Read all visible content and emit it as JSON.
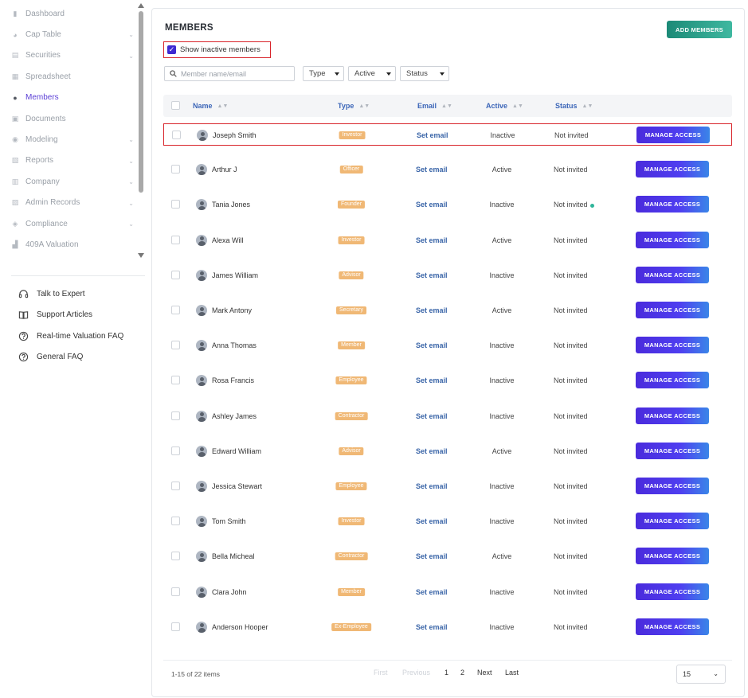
{
  "sidebar": {
    "nav": [
      {
        "label": "Dashboard",
        "icon": "dashboard-icon",
        "has_chevron": false
      },
      {
        "label": "Cap Table",
        "icon": "pie-chart-icon",
        "has_chevron": true
      },
      {
        "label": "Securities",
        "icon": "clipboard-icon",
        "has_chevron": true
      },
      {
        "label": "Spreadsheet",
        "icon": "spreadsheet-icon",
        "has_chevron": false
      },
      {
        "label": "Members",
        "icon": "user-icon",
        "has_chevron": false,
        "active": true
      },
      {
        "label": "Documents",
        "icon": "documents-icon",
        "has_chevron": false
      },
      {
        "label": "Modeling",
        "icon": "lightbulb-icon",
        "has_chevron": true
      },
      {
        "label": "Reports",
        "icon": "reports-icon",
        "has_chevron": true
      },
      {
        "label": "Company",
        "icon": "company-icon",
        "has_chevron": true
      },
      {
        "label": "Admin Records",
        "icon": "admin-records-icon",
        "has_chevron": true
      },
      {
        "label": "Compliance",
        "icon": "shield-icon",
        "has_chevron": true
      },
      {
        "label": "409A Valuation",
        "icon": "valuation-icon",
        "has_chevron": false
      }
    ],
    "help": [
      {
        "label": "Talk to Expert",
        "icon": "headset-icon"
      },
      {
        "label": "Support Articles",
        "icon": "book-icon"
      },
      {
        "label": "Real-time Valuation FAQ",
        "icon": "question-circle-icon"
      },
      {
        "label": "General FAQ",
        "icon": "question-circle-icon"
      }
    ]
  },
  "main": {
    "title": "MEMBERS",
    "add_button": "ADD MEMBERS",
    "show_inactive_label": "Show inactive members",
    "show_inactive_checked": true,
    "search_placeholder": "Member name/email",
    "filters": [
      "Type",
      "Active",
      "Status"
    ],
    "columns": [
      "Name",
      "Type",
      "Email",
      "Active",
      "Status"
    ],
    "rows": [
      {
        "name": "Joseph Smith",
        "type": "Investor",
        "email": "Set email",
        "active": "Inactive",
        "status": "Not invited",
        "status_dot": false,
        "action": "MANAGE ACCESS",
        "highlighted": true
      },
      {
        "name": "Arthur J",
        "type": "Officer",
        "email": "Set email",
        "active": "Active",
        "status": "Not invited",
        "status_dot": false,
        "action": "MANAGE ACCESS"
      },
      {
        "name": "Tania Jones",
        "type": "Founder",
        "email": "Set email",
        "active": "Inactive",
        "status": "Not invited",
        "status_dot": true,
        "action": "MANAGE ACCESS"
      },
      {
        "name": "Alexa Will",
        "type": "Investor",
        "email": "Set email",
        "active": "Active",
        "status": "Not invited",
        "status_dot": false,
        "action": "MANAGE ACCESS"
      },
      {
        "name": "James William",
        "type": "Advisor",
        "email": "Set email",
        "active": "Inactive",
        "status": "Not invited",
        "status_dot": false,
        "action": "MANAGE ACCESS"
      },
      {
        "name": "Mark Antony",
        "type": "Secretary",
        "email": "Set email",
        "active": "Active",
        "status": "Not invited",
        "status_dot": false,
        "action": "MANAGE ACCESS"
      },
      {
        "name": "Anna Thomas",
        "type": "Member",
        "email": "Set email",
        "active": "Inactive",
        "status": "Not invited",
        "status_dot": false,
        "action": "MANAGE ACCESS"
      },
      {
        "name": "Rosa Francis",
        "type": "Employee",
        "email": "Set email",
        "active": "Inactive",
        "status": "Not invited",
        "status_dot": false,
        "action": "MANAGE ACCESS"
      },
      {
        "name": "Ashley James",
        "type": "Contractor",
        "email": "Set email",
        "active": "Inactive",
        "status": "Not invited",
        "status_dot": false,
        "action": "MANAGE ACCESS"
      },
      {
        "name": "Edward William",
        "type": "Advisor",
        "email": "Set email",
        "active": "Active",
        "status": "Not invited",
        "status_dot": false,
        "action": "MANAGE ACCESS"
      },
      {
        "name": "Jessica Stewart",
        "type": "Employee",
        "email": "Set email",
        "active": "Inactive",
        "status": "Not invited",
        "status_dot": false,
        "action": "MANAGE ACCESS"
      },
      {
        "name": "Tom Smith",
        "type": "Investor",
        "email": "Set email",
        "active": "Inactive",
        "status": "Not invited",
        "status_dot": false,
        "action": "MANAGE ACCESS"
      },
      {
        "name": "Bella Micheal",
        "type": "Contractor",
        "email": "Set email",
        "active": "Active",
        "status": "Not invited",
        "status_dot": false,
        "action": "MANAGE ACCESS"
      },
      {
        "name": "Clara John",
        "type": "Member",
        "email": "Set email",
        "active": "Inactive",
        "status": "Not invited",
        "status_dot": false,
        "action": "MANAGE ACCESS"
      },
      {
        "name": "Anderson Hooper",
        "type": "Ex-Employee",
        "email": "Set email",
        "active": "Inactive",
        "status": "Not invited",
        "status_dot": false,
        "action": "MANAGE ACCESS"
      }
    ],
    "pagination": {
      "summary": "1-15 of 22 items",
      "first": "First",
      "previous": "Previous",
      "pages": [
        "1",
        "2"
      ],
      "current_page": "1",
      "next": "Next",
      "last": "Last",
      "page_size": "15"
    }
  },
  "colors": {
    "accent": "#5b3fd6",
    "manage_button": "#4a2bdc",
    "add_button": "#1c8a77",
    "badge": "#f0b875",
    "highlight_border": "#d8232a",
    "header_text": "#3c66b8",
    "status_dot": "#2fb59a"
  }
}
